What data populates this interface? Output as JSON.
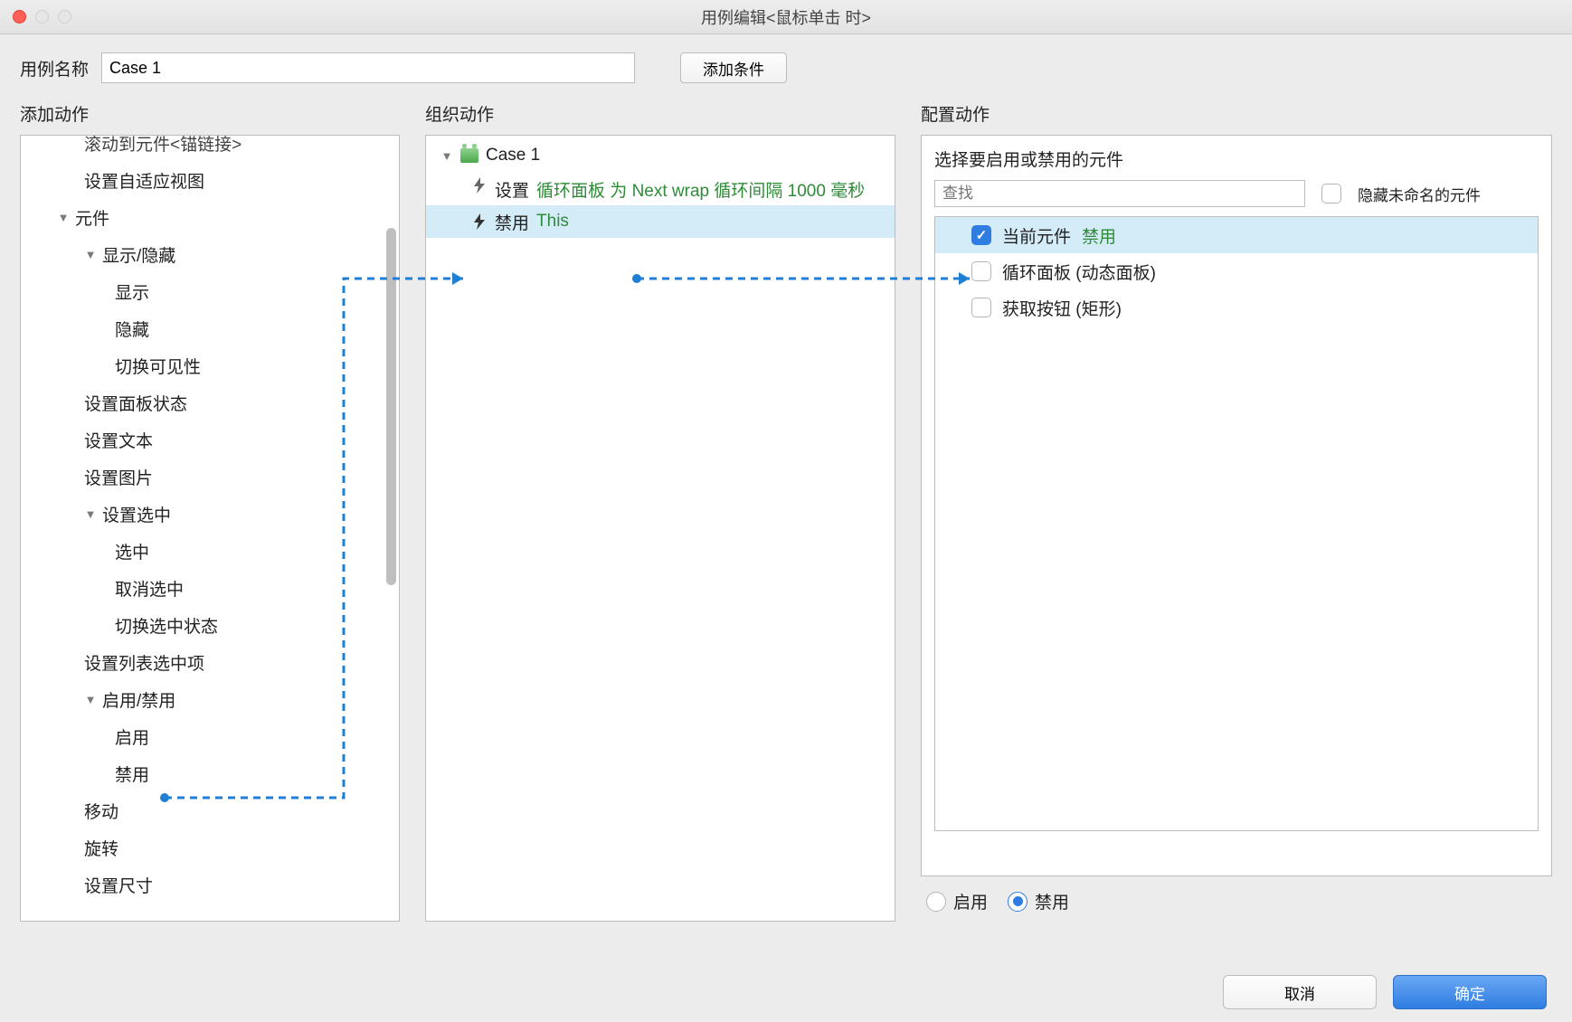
{
  "window": {
    "title": "用例编辑<鼠标单击 时>"
  },
  "top": {
    "case_name_label": "用例名称",
    "case_name_value": "Case 1",
    "add_condition_btn": "添加条件"
  },
  "sections": {
    "add_action": "添加动作",
    "organize_action": "组织动作",
    "configure_action": "配置动作"
  },
  "tree": {
    "scroll_to_widget": "滚动到元件<锚链接>",
    "set_adaptive_view": "设置自适应视图",
    "widgets": "元件",
    "show_hide": "显示/隐藏",
    "show": "显示",
    "hide": "隐藏",
    "toggle_visibility": "切换可见性",
    "set_panel_state": "设置面板状态",
    "set_text": "设置文本",
    "set_image": "设置图片",
    "set_selected": "设置选中",
    "selected": "选中",
    "unselected": "取消选中",
    "toggle_selected": "切换选中状态",
    "set_list_selected": "设置列表选中项",
    "enable_disable": "启用/禁用",
    "enable": "启用",
    "disable": "禁用",
    "move": "移动",
    "rotate": "旋转",
    "set_size": "设置尺寸"
  },
  "organize": {
    "case_label": "Case 1",
    "action1_prefix": "设置",
    "action1_body": "循环面板 为 Next wrap 循环间隔 1000 毫秒",
    "action2_prefix": "禁用",
    "action2_target": "This"
  },
  "config": {
    "title": "选择要启用或禁用的元件",
    "search_placeholder": "查找",
    "hide_unnamed": "隐藏未命名的元件",
    "el_current": "当前元件",
    "el_current_state": "禁用",
    "el_panel": "循环面板 (动态面板)",
    "el_button": "获取按钮 (矩形)",
    "radio_enable": "启用",
    "radio_disable": "禁用"
  },
  "footer": {
    "cancel": "取消",
    "ok": "确定"
  }
}
